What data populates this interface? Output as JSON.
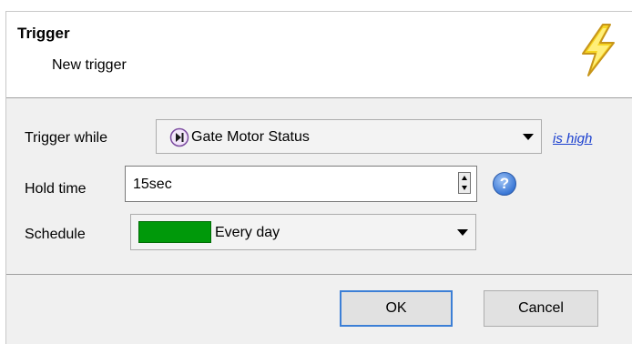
{
  "header": {
    "title": "Trigger",
    "subtitle": "New trigger",
    "icon": "lightning-bolt-icon"
  },
  "form": {
    "trigger_while": {
      "label": "Trigger while",
      "value": "Gate Motor Status",
      "icon": "digital-input-icon",
      "condition_link": "is high"
    },
    "hold_time": {
      "label": "Hold time",
      "value": "15sec",
      "help_icon": "help-icon"
    },
    "schedule": {
      "label": "Schedule",
      "value": "Every day",
      "swatch_color": "#00990a"
    }
  },
  "buttons": {
    "ok": "OK",
    "cancel": "Cancel"
  }
}
